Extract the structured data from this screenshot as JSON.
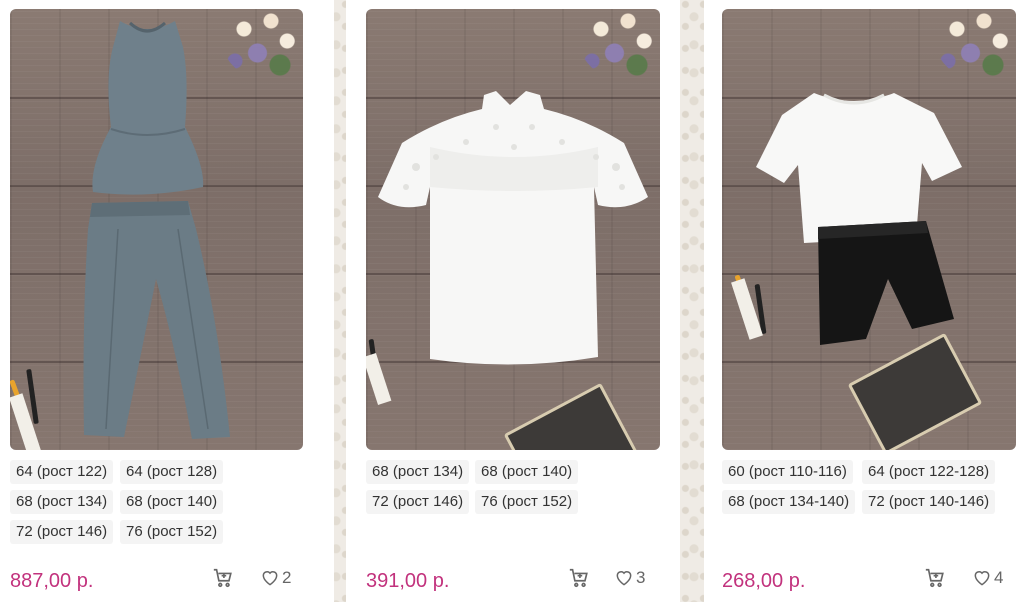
{
  "colors": {
    "price": "#c2327d",
    "chip_bg": "#f4f4f4",
    "icon": "#666666"
  },
  "products": [
    {
      "image": "grey sleeveless peplum top and trousers",
      "sizes": [
        "64 (рост 122)",
        "64 (рост 128)",
        "68 (рост 134)",
        "68 (рост 140)",
        "72 (рост 146)",
        "76 (рост 152)"
      ],
      "price": "887,00 р.",
      "favorites": "2",
      "cart_icon": "cart-icon",
      "fav_icon": "heart-icon"
    },
    {
      "image": "white blouse with lace yoke",
      "sizes": [
        "68 (рост 134)",
        "68 (рост 140)",
        "72 (рост 146)",
        "76 (рост 152)"
      ],
      "price": "391,00 р.",
      "favorites": "3",
      "cart_icon": "cart-icon",
      "fav_icon": "heart-icon"
    },
    {
      "image": "white t-shirt and black shorts",
      "sizes": [
        "60 (рост 110-116)",
        "64 (рост 122-128)",
        "68 (рост 134-140)",
        "72 (рост 140-146)"
      ],
      "price": "268,00 р.",
      "favorites": "4",
      "cart_icon": "cart-icon",
      "fav_icon": "heart-icon"
    }
  ]
}
